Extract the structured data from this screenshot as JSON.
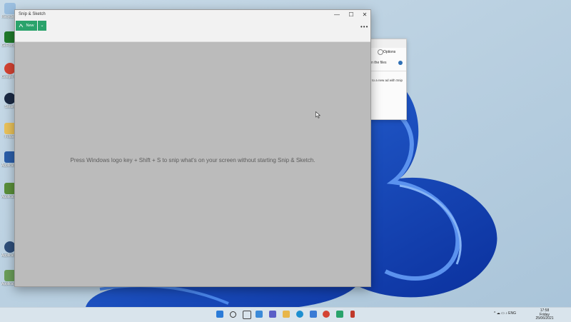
{
  "desktop": {
    "icons": [
      {
        "label": "Recycle Bin",
        "icon": "recycle-bin-icon",
        "color": "#9bbfe0"
      },
      {
        "label": "GeForce Experience",
        "icon": "nvidia-icon",
        "color": "#1f7a2b"
      },
      {
        "label": "Google Chrome",
        "icon": "chrome-icon",
        "color": "#d44333"
      },
      {
        "label": "Steam",
        "icon": "steam-icon",
        "color": "#1b2a44"
      },
      {
        "label": "Folder",
        "icon": "folder-icon",
        "color": "#e8c15a"
      },
      {
        "label": "Application",
        "icon": "app-icon",
        "color": "#2b5ea8"
      },
      {
        "label": "Application",
        "icon": "app-icon",
        "color": "#5a8f3a"
      },
      {
        "label": "Application",
        "icon": "app-icon",
        "color": "#2f4f7a"
      },
      {
        "label": "Application",
        "icon": "app-icon",
        "color": "#6a9e5a"
      }
    ]
  },
  "background_window": {
    "options_label": "Options",
    "line1": "in the files",
    "line2": "ng to a new ad with Snip"
  },
  "snip": {
    "title": "Snip & Sketch",
    "new_label": "New",
    "dropdown_glyph": "⌄",
    "more_glyph": "•••",
    "hint": "Press Windows logo key + Shift + S to snip what's on your screen without starting Snip & Sketch.",
    "minimize_glyph": "—",
    "maximize_glyph": "☐",
    "close_glyph": "✕"
  },
  "taskbar": {
    "tray_text": "^ ☁ ▭ ♪ ENG",
    "time": "17:58",
    "day": "Friday",
    "date": "25/06/2021",
    "apps": [
      {
        "icon": "start-icon",
        "color": "#2b7bd8"
      },
      {
        "icon": "search-icon",
        "color": "#333333"
      },
      {
        "icon": "task-view-icon",
        "color": "#444444"
      },
      {
        "icon": "widgets-icon",
        "color": "#3b8ad8"
      },
      {
        "icon": "chat-icon",
        "color": "#5b5fc7"
      },
      {
        "icon": "file-explorer-icon",
        "color": "#e8b64a"
      },
      {
        "icon": "edge-icon",
        "color": "#1e8fd0"
      },
      {
        "icon": "store-icon",
        "color": "#3a7bd5"
      },
      {
        "icon": "chrome-icon",
        "color": "#d44333"
      },
      {
        "icon": "snip-icon",
        "color": "#2aa36b"
      },
      {
        "icon": "app-icon",
        "color": "#c0392b"
      }
    ]
  },
  "colors": {
    "accent": "#2aa36b",
    "canvas": "#bbbbbb"
  }
}
